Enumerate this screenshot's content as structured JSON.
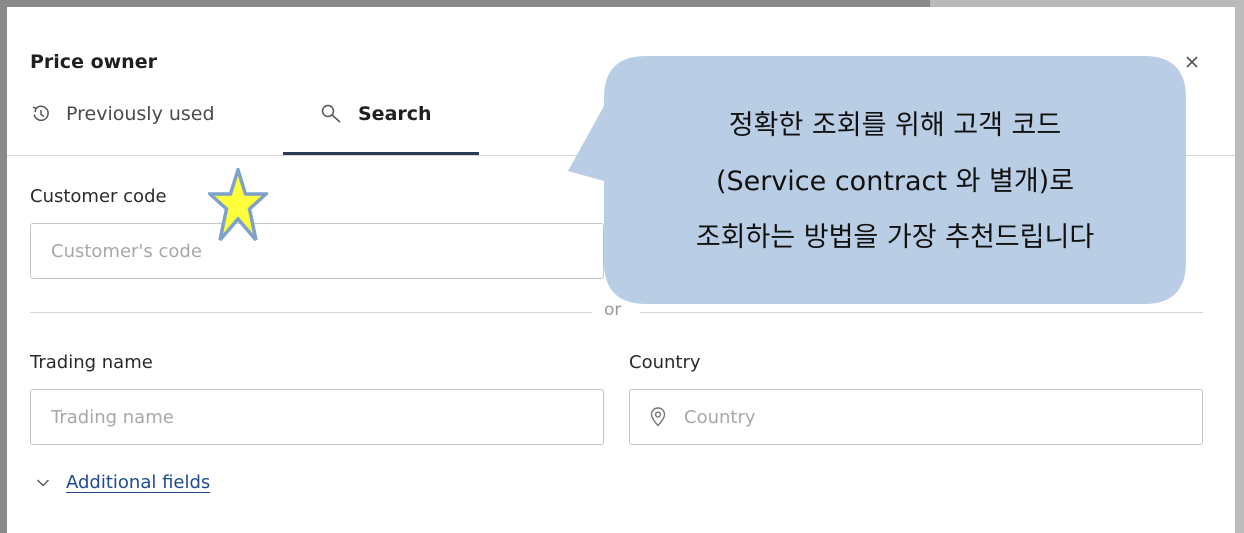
{
  "panel": {
    "title": "Price owner",
    "close_icon": "close-icon"
  },
  "tabs": [
    {
      "label": "Previously used",
      "icon": "history-icon",
      "active": false
    },
    {
      "label": "Search",
      "icon": "search-icon",
      "active": true
    }
  ],
  "form": {
    "customer_code": {
      "label": "Customer code",
      "placeholder": "Customer's code",
      "value": ""
    },
    "divider_text": "or",
    "trading_name": {
      "label": "Trading name",
      "placeholder": "Trading name",
      "value": ""
    },
    "country": {
      "label": "Country",
      "placeholder": "Country",
      "value": "",
      "icon": "location-pin-icon"
    },
    "additional_fields": {
      "label": "Additional fields",
      "icon": "chevron-down-icon"
    }
  },
  "annotation": {
    "lines": [
      "정확한 조회를 위해 고객 코드",
      "(Service contract 와 별개)로",
      "조회하는 방법을 가장 추천드립니다"
    ],
    "bubble_color": "#b9cde5",
    "star_color": "#ffff3c",
    "star_outline": "#7ea1cc"
  },
  "colors": {
    "active_tab_underline": "#2d3b52",
    "link": "#1f4a8c",
    "input_border": "#c5c5c5"
  }
}
